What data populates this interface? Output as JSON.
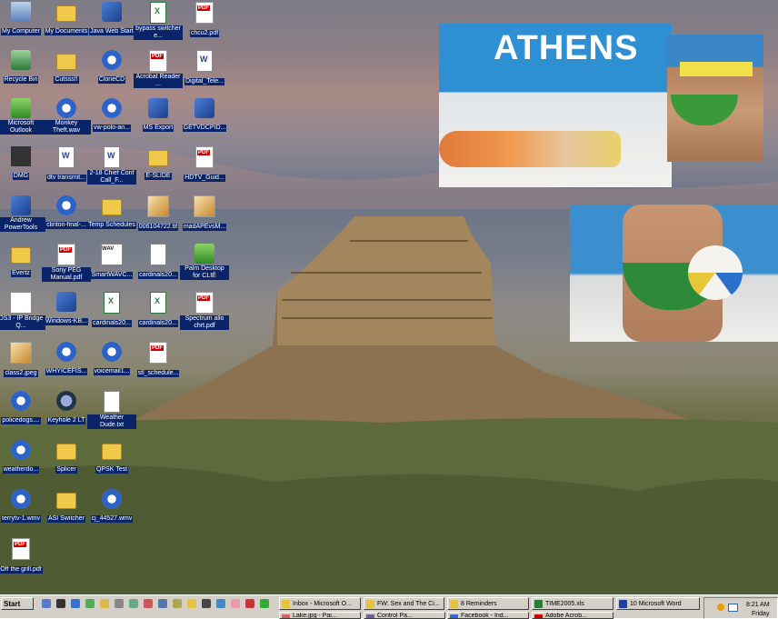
{
  "desktop": {
    "icons": [
      {
        "label": "My Computer",
        "glyph": "computer-icon"
      },
      {
        "label": "My Documents",
        "glyph": "folder-icon"
      },
      {
        "label": "Java Web Start",
        "glyph": "java-icon"
      },
      {
        "label": "bypass switcher e...",
        "glyph": "excel-icon"
      },
      {
        "label": "chcu2.pdf",
        "glyph": "pdf-icon"
      },
      {
        "label": "Recycle Bin",
        "glyph": "recycle-bin-icon"
      },
      {
        "label": "Cutsss!!",
        "glyph": "folder-icon"
      },
      {
        "label": "CloneCD",
        "glyph": "clonecd-icon"
      },
      {
        "label": "Acrobat Reader ...",
        "glyph": "acrobat-icon"
      },
      {
        "label": "Digital_Tele...",
        "glyph": "word-icon"
      },
      {
        "label": "Microsoft Outlook",
        "glyph": "outlook-icon"
      },
      {
        "label": "Monkey Theft.wav",
        "glyph": "media-icon"
      },
      {
        "label": "vw-polo-an...",
        "glyph": "media-icon"
      },
      {
        "label": "MS Export",
        "glyph": "app-icon"
      },
      {
        "label": "GETVDCPID...",
        "glyph": "app-icon"
      },
      {
        "label": "DMG",
        "glyph": "dmg-icon"
      },
      {
        "label": "dtv transmit...",
        "glyph": "word-icon"
      },
      {
        "label": "2-18 Chief Conf Call_F...",
        "glyph": "word-icon"
      },
      {
        "label": "E-SLIDE",
        "glyph": "folder-icon"
      },
      {
        "label": "HDTV_Guid...",
        "glyph": "pdf-icon"
      },
      {
        "label": "Andrew PowerTools",
        "glyph": "app-icon"
      },
      {
        "label": "clinton-final-...",
        "glyph": "media-icon"
      },
      {
        "label": "Temp Schedules",
        "glyph": "folder-icon"
      },
      {
        "label": "006104722.tif",
        "glyph": "image-icon"
      },
      {
        "label": "madAPEvsM...",
        "glyph": "image-icon"
      },
      {
        "label": "Evertz",
        "glyph": "folder-icon"
      },
      {
        "label": "Sony PEG Manual.pdf",
        "glyph": "pdf-icon"
      },
      {
        "label": "SmartWAVC...",
        "glyph": "wav-icon"
      },
      {
        "label": "cardinals20...",
        "glyph": "document-icon"
      },
      {
        "label": "Palm Desktop for CLIÉ",
        "glyph": "palm-icon"
      },
      {
        "label": "DS3 - IP Bridge Q...",
        "glyph": "mail-icon"
      },
      {
        "label": "Windows-KB...",
        "glyph": "app-icon"
      },
      {
        "label": "cardinals20...",
        "glyph": "excel-icon"
      },
      {
        "label": "cardinals20...",
        "glyph": "excel-icon"
      },
      {
        "label": "Spectrum allo chrt.pdf",
        "glyph": "pdf-icon"
      },
      {
        "label": "class2.jpeg",
        "glyph": "image-icon"
      },
      {
        "label": "WHYICEFIS...",
        "glyph": "media-icon"
      },
      {
        "label": "voicemail1...",
        "glyph": "media-icon"
      },
      {
        "label": "stl_schedule...",
        "glyph": "pdf-icon"
      },
      {
        "label": "policedogs....",
        "glyph": "media-icon"
      },
      {
        "label": "Keyhole 2 LT",
        "glyph": "globe-icon"
      },
      {
        "label": "Weather Dude.txt",
        "glyph": "document-icon"
      },
      {
        "label": "weatherdo...",
        "glyph": "media-icon"
      },
      {
        "label": "Splicer",
        "glyph": "folder-icon"
      },
      {
        "label": "QPSK Test",
        "glyph": "folder-icon"
      },
      {
        "label": "terrytv-1.wmv",
        "glyph": "media-icon"
      },
      {
        "label": "ASI Switcher",
        "glyph": "folder-icon"
      },
      {
        "label": "cj_44527.wmv",
        "glyph": "media-icon"
      },
      {
        "label": "Off the grill.pdf",
        "glyph": "pdf-icon"
      }
    ],
    "photos": {
      "athens_banner": "ATHENS"
    }
  },
  "taskbar": {
    "start_label": "Start",
    "tasks": [
      {
        "label": "Inbox - Microsoft O...",
        "icon": "outlook-icon",
        "color": "#e6c240"
      },
      {
        "label": "FW: Sex and The Ci...",
        "icon": "mail-icon",
        "color": "#e6c240"
      },
      {
        "label": "8 Reminders",
        "icon": "reminder-icon",
        "color": "#e6c240"
      },
      {
        "label": "TIME2005.xls",
        "icon": "excel-icon",
        "color": "#2a7a3a"
      },
      {
        "label": "10 Microsoft Word",
        "icon": "word-icon",
        "color": "#1f3fa8"
      }
    ],
    "tasks_row2": [
      {
        "label": "Lake.jpg - Pai...",
        "icon": "paint-icon",
        "color": "#c66"
      },
      {
        "label": "Control Pa...",
        "icon": "control-panel-icon",
        "color": "#669"
      },
      {
        "label": "Facebook - Ind...",
        "icon": "browser-icon",
        "color": "#36c"
      },
      {
        "label": "Adobe Acrob...",
        "icon": "acrobat-icon",
        "color": "#c00"
      }
    ],
    "clock": "8:21 AM",
    "day": "Friday"
  }
}
